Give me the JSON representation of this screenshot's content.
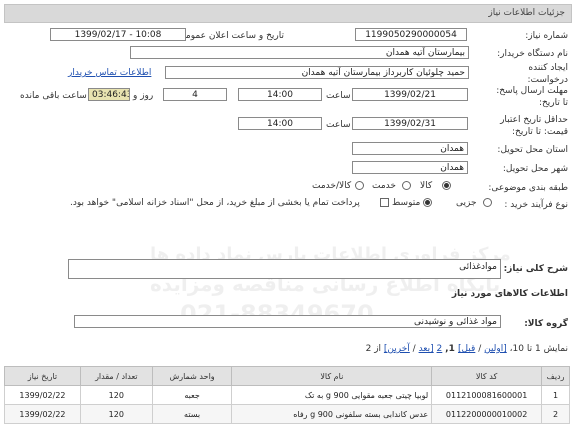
{
  "header": {
    "title": "جزئیات اطلاعات نیاز"
  },
  "fields": {
    "need_number_label": "شماره نیاز:",
    "need_number": "1199050290000054",
    "announce_label": "تاریخ و ساعت اعلان عمومی:",
    "announce_value": "1399/02/17 - 10:08",
    "buyer_label": "نام دستگاه خریدار:",
    "buyer_value": "بیمارستان آتیه همدان",
    "creator_label_1": "ایجاد کننده",
    "creator_label_2": "درخواست:",
    "creator_value": "حمید چلوئیان  کاربرداز بیمارستان آتیه همدان",
    "contact_link": "اطلاعات تماس خریدار",
    "deadline_label_1": "مهلت ارسال پاسخ:",
    "deadline_label_2": "تا تاریخ:",
    "deadline_date": "1399/02/21",
    "time_label": "ساعت",
    "deadline_time": "14:00",
    "days_value": "4",
    "days_label": "روز و",
    "remaining_timer": "03:46:43",
    "remaining_label": "ساعت باقی مانده",
    "validity_label_1": "حداقل تاریخ اعتبار",
    "validity_label_2": "قیمت: تا تاریخ:",
    "validity_date": "1399/02/31",
    "validity_time": "14:00",
    "province_label": "استان محل تحویل:",
    "province_value": "همدان",
    "city_label": "شهر محل تحویل:",
    "city_value": "همدان",
    "category_label": "طبقه بندی موضوعی:",
    "category_options": [
      "کالا",
      "خدمت",
      "کالا/خدمت"
    ],
    "process_label": "نوع فرآیند خرید :",
    "process_options": [
      "جزیی",
      "متوسط"
    ],
    "payment_note": "پرداخت تمام یا بخشی از مبلغ خرید، از محل \"اسناد خزانه اسلامی\" خواهد بود."
  },
  "summary": {
    "label": "شرح کلی نیاز:",
    "value": "موادغذائی"
  },
  "goods": {
    "section_title": "اطلاعات کالاهای مورد نیاز",
    "group_label": "گروه کالا:",
    "group_value": "مواد غذائی و نوشیدنی"
  },
  "pagination": {
    "text_a": "نمایش 1 تا 10، ",
    "first": "[اولین",
    "sep1": " / ",
    "prev": "قبل]",
    "page_bold": " 1,",
    "page2": "2",
    "next": "[بعد",
    "last": "آخرین]",
    "text_b": " از 2"
  },
  "table": {
    "headers": [
      "ردیف",
      "کد کالا",
      "نام کالا",
      "واحد شمارش",
      "تعداد / مقدار",
      "تاریخ نیاز"
    ],
    "rows": [
      {
        "row": "1",
        "code": "0112100081600001",
        "name": "لوبیا چیتی جعبه مقوایی 900 g به تک",
        "unit": "جعبه",
        "qty": "120",
        "date": "1399/02/22"
      },
      {
        "row": "2",
        "code": "0112200000010002",
        "name": "عدس کاندابی بسته سلفونی 900 g رفاه",
        "unit": "بسته",
        "qty": "120",
        "date": "1399/02/22"
      }
    ]
  },
  "watermark": {
    "line1": "مرکز فراوری اطلاعات پارس نماد داده ها",
    "line2": "پایگاه اطلاع رسانی مناقصه ومزایده",
    "line3": "021-88349670"
  }
}
